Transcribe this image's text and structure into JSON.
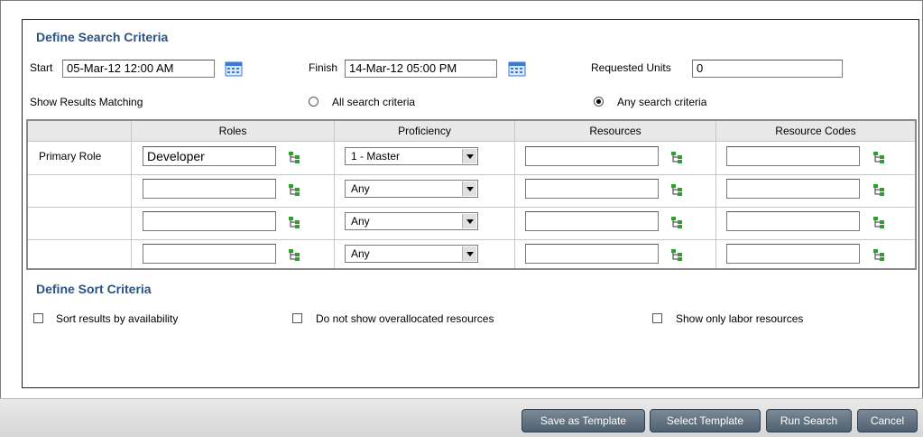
{
  "search": {
    "title": "Define Search Criteria",
    "start_label": "Start",
    "start_value": "05-Mar-12 12:00 AM",
    "finish_label": "Finish",
    "finish_value": "14-Mar-12 05:00 PM",
    "units_label": "Requested Units",
    "units_value": "0",
    "show_results_label": "Show Results Matching",
    "radio_all": "All search criteria",
    "radio_any": "Any search criteria",
    "selected_match": "Any search criteria"
  },
  "grid": {
    "headers": [
      "Roles",
      "Proficiency",
      "Resources",
      "Resource Codes"
    ],
    "rows": [
      {
        "label": "Primary Role",
        "role": "Developer",
        "proficiency": "1 - Master",
        "resource": "",
        "resource_code": ""
      },
      {
        "label": "",
        "role": "",
        "proficiency": "Any",
        "resource": "",
        "resource_code": ""
      },
      {
        "label": "",
        "role": "",
        "proficiency": "Any",
        "resource": "",
        "resource_code": ""
      },
      {
        "label": "",
        "role": "",
        "proficiency": "Any",
        "resource": "",
        "resource_code": ""
      }
    ]
  },
  "sort": {
    "title": "Define Sort Criteria",
    "options": [
      {
        "label": "Sort results by availability",
        "checked": false
      },
      {
        "label": "Do not show overallocated resources",
        "checked": false
      },
      {
        "label": "Show only labor resources",
        "checked": false
      }
    ]
  },
  "footer": {
    "save_template": "Save as Template",
    "select_template": "Select Template",
    "run_search": "Run Search",
    "cancel": "Cancel"
  },
  "colors": {
    "section_title": "#2c5282",
    "button_bg": "#5a6b7b",
    "tree_icon_green": "#2e9e2e",
    "calendar_blue": "#3a7bd5"
  },
  "icons": {
    "calendar": "calendar-icon",
    "lookup": "hierarchy-lookup-icon"
  }
}
